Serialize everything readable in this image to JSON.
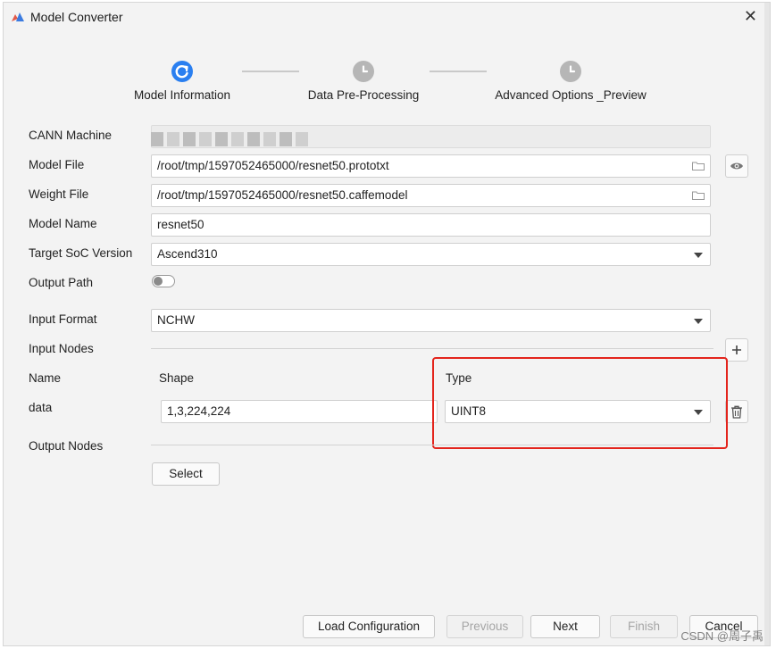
{
  "window": {
    "title": "Model Converter",
    "close_icon": "close-icon"
  },
  "steps": [
    {
      "label": "Model Information",
      "state": "active",
      "icon": "refresh-icon"
    },
    {
      "label": "Data Pre-Processing",
      "state": "pending",
      "icon": "clock-icon"
    },
    {
      "label": "Advanced Options _Preview",
      "state": "pending",
      "icon": "clock-icon"
    }
  ],
  "form": {
    "cann_machine": {
      "label": "CANN Machine",
      "value": ""
    },
    "model_file": {
      "label": "Model File",
      "value": "/root/tmp/1597052465000/resnet50.prototxt",
      "icon": "folder-icon",
      "action_icon": "eye-icon"
    },
    "weight_file": {
      "label": "Weight File",
      "value": "/root/tmp/1597052465000/resnet50.caffemodel",
      "icon": "folder-icon"
    },
    "model_name": {
      "label": "Model Name",
      "value": "resnet50"
    },
    "target_soc": {
      "label": "Target SoC Version",
      "value": "Ascend310"
    },
    "output_path": {
      "label": "Output Path",
      "enabled": false
    },
    "input_format": {
      "label": "Input Format",
      "value": "NCHW"
    },
    "input_nodes": {
      "label": "Input Nodes",
      "add_icon": "plus-icon",
      "headers": {
        "name": "Name",
        "shape": "Shape",
        "type": "Type"
      },
      "rows": [
        {
          "name": "data",
          "shape": "1,3,224,224",
          "type": "UINT8",
          "delete_icon": "trash-icon"
        }
      ]
    },
    "output_nodes": {
      "label": "Output Nodes",
      "select_label": "Select"
    }
  },
  "footer": {
    "load_configuration": "Load Configuration",
    "previous": "Previous",
    "next": "Next",
    "finish": "Finish",
    "cancel": "Cancel"
  },
  "watermark": "CSDN @周子禹",
  "colors": {
    "accent": "#2a7ff0",
    "highlight": "#e3241c",
    "background": "#f3f3f3"
  }
}
